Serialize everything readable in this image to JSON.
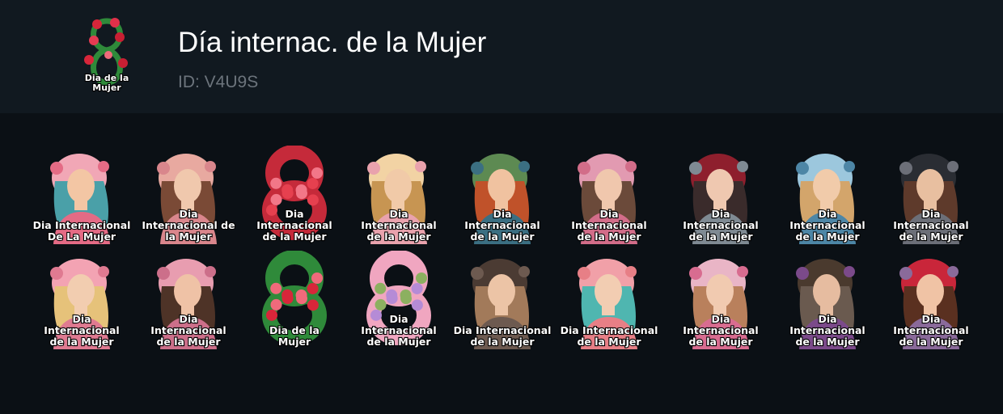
{
  "pack": {
    "title": "Día internac. de la Mujer",
    "id_text": "ID: V4U9S",
    "icon_caption": [
      "Dia de la",
      "Mujer"
    ]
  },
  "stickers": [
    {
      "lines": [
        "Dia  Internacional",
        "De La Mujer"
      ],
      "icon": "woman-with-flowers-icon"
    },
    {
      "lines": [
        "Dia",
        "Internacional de",
        "la Mujer"
      ],
      "icon": "woman-in-pink-hat-icon"
    },
    {
      "lines": [
        "Dia",
        "Internacional",
        "de la Mujer"
      ],
      "icon": "tulip-number-eight-icon"
    },
    {
      "lines": [
        "Dia",
        "Internacional",
        "de la Mujer"
      ],
      "icon": "blonde-woman-profile-icon"
    },
    {
      "lines": [
        "Dia",
        "Internacional",
        "de la Mujer"
      ],
      "icon": "woman-with-flower-crown-icon"
    },
    {
      "lines": [
        "Dia",
        "Internacional",
        "de la Mujer"
      ],
      "icon": "woman-resting-chin-icon"
    },
    {
      "lines": [
        "Dia",
        "Internacional",
        "de la Mujer"
      ],
      "icon": "woman-in-red-beret-icon"
    },
    {
      "lines": [
        "Dia",
        "Internacional",
        "de la Mujer"
      ],
      "icon": "woman-in-blue-hat-icon"
    },
    {
      "lines": [
        "Dia",
        "Internacional",
        "de la Mujer"
      ],
      "icon": "woman-in-black-hat-icon"
    },
    {
      "lines": [
        "Dia",
        "Internacional",
        "de la Mujer"
      ],
      "icon": "woman-with-flower-hair-icon"
    },
    {
      "lines": [
        "Dia",
        "Internacional",
        "de la Mujer"
      ],
      "icon": "woman-in-pink-dress-icon"
    },
    {
      "lines": [
        "Dia de la",
        "Mujer"
      ],
      "icon": "tulip-eight-icon"
    },
    {
      "lines": [
        "Dia",
        "Internacional",
        "de la Mujer"
      ],
      "icon": "floral-number-eight-icon"
    },
    {
      "lines": [
        "Dia Internacional",
        "de la Mujer"
      ],
      "icon": "woman-with-braid-icon"
    },
    {
      "lines": [
        "Dia Internacional",
        "de la Mujer"
      ],
      "icon": "woman-with-tulip-eight-icon"
    },
    {
      "lines": [
        "Dia",
        "Internacional",
        "de la Mujer"
      ],
      "icon": "woman-with-roses-icon"
    },
    {
      "lines": [
        "Dia",
        "Internacional",
        "de la Mujer"
      ],
      "icon": "woman-in-wide-hat-icon"
    },
    {
      "lines": [
        "Dia",
        "Internacional",
        "de la Mujer"
      ],
      "icon": "woman-with-red-rose-icon"
    }
  ]
}
